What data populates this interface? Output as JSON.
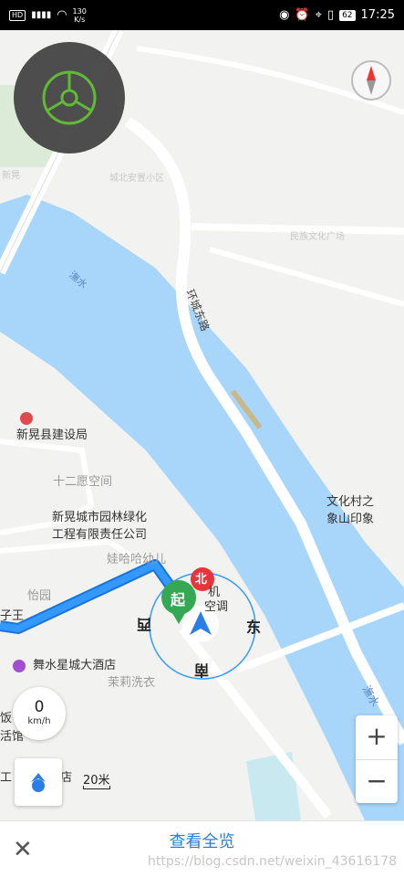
{
  "status_bar": {
    "hd": "HD",
    "signal": "4G",
    "net_speed_value": "130",
    "net_speed_unit": "K/s",
    "battery": "62",
    "time": "17:25"
  },
  "map": {
    "river_label": "潕水",
    "river_label_2": "潕水",
    "road_label": "环城东路",
    "pois": {
      "county_bureau": "新晃县建设局",
      "twelve_space": "十二愿空间",
      "garden_co_line1": "新晃城市园林绿化",
      "garden_co_line2": "工程有限责任公司",
      "wahaha": "娃哈哈幼儿",
      "yiyuan": "怡园",
      "hotel": "舞水星城大酒店",
      "laundry": "茉莉洗衣",
      "culture_line1": "文化村之",
      "culture_line2": "象山印象",
      "wang": "子王",
      "pin_text": "起",
      "north_badge": "北",
      "bind": "饭",
      "hall": "活馆",
      "store": "工",
      "store2": "店",
      "ac": "空调",
      "ji": "机"
    },
    "faint_labels": [
      "城北安置小区",
      "民族文化广场",
      "新晃"
    ],
    "directions": {
      "north": "北",
      "east": "东",
      "south": "南",
      "west": "西"
    }
  },
  "speed": {
    "value": "0",
    "unit": "km/h"
  },
  "scale": "20米",
  "zoom": {
    "in": "+",
    "out": "−"
  },
  "bottom": {
    "overview_label": "查看全览",
    "watermark": "https://blog.csdn.net/weixin_43616178"
  },
  "colors": {
    "river": "#a8d6fb",
    "route": "#3399ff",
    "route_border": "#1a73d9",
    "overview_text": "#2d7ed8",
    "steering_green": "#5ab82e",
    "map_bg": "#f2f2f0"
  }
}
